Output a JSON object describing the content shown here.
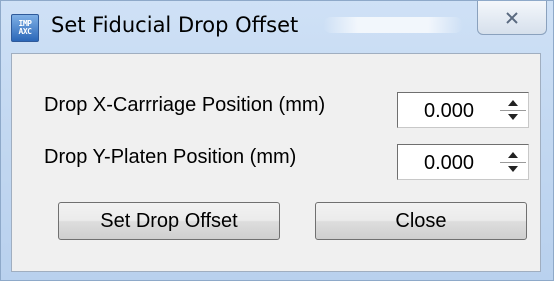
{
  "window": {
    "title": "Set Fiducial Drop Offset",
    "icon_text": [
      "IMP",
      "AXC"
    ]
  },
  "fields": {
    "x_label": "Drop X-Carrriage Position (mm)",
    "x_value": "0.000",
    "y_label": "Drop Y-Platen Position (mm)",
    "y_value": "0.000"
  },
  "buttons": {
    "set_offset": "Set Drop Offset",
    "close": "Close"
  }
}
